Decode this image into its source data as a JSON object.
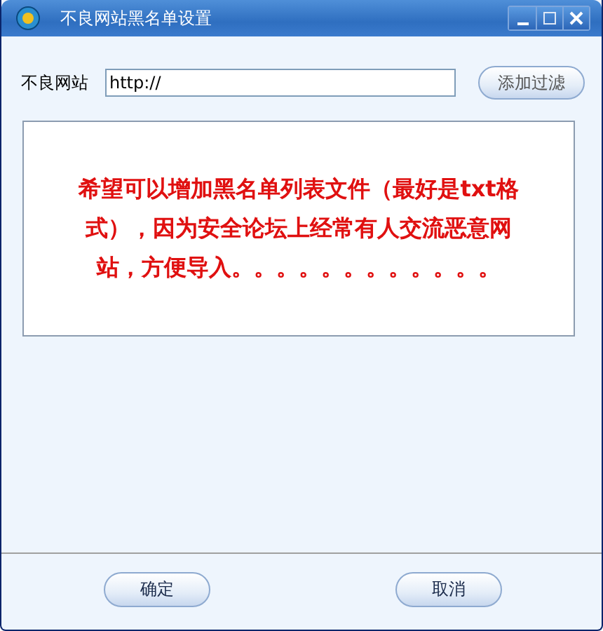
{
  "window": {
    "title": "不良网站黑名单设置"
  },
  "url_row": {
    "label": "不良网站",
    "value": "http://",
    "button": "添加过滤"
  },
  "note": "希望可以增加黑名单列表文件（最好是txt格式），因为安全论坛上经常有人交流恶意网站，方便导入。。。。。。。。。。。。",
  "buttons": [
    "确定",
    "取消"
  ]
}
